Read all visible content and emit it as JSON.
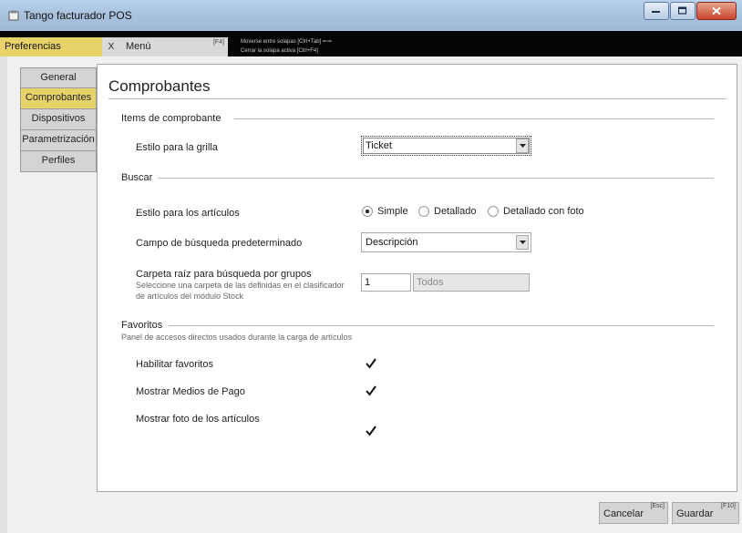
{
  "window": {
    "title": "Tango facturador POS"
  },
  "tabs": {
    "preferencias": "Preferencias",
    "close": "X",
    "menu": "Menú",
    "menu_key": "[F4]",
    "hint1": "Moverse entre solapas [Ctrl+Tab] ⇐⇒",
    "hint2": "Cerrar la solapa activa [Ctrl+F4]"
  },
  "nav": {
    "items": [
      "General",
      "Comprobantes",
      "Dispositivos",
      "Parametrización",
      "Perfiles"
    ],
    "active": "Comprobantes"
  },
  "panel": {
    "title": "Comprobantes",
    "items_section": {
      "label": "Items de comprobante",
      "grid_style_label": "Estilo para la grilla",
      "grid_style_value": "Ticket"
    },
    "buscar_section": {
      "label": "Buscar",
      "article_style_label": "Estilo para los artículos",
      "options": [
        "Simple",
        "Detallado",
        "Detallado con foto"
      ],
      "selected_option": "Simple",
      "default_field_label": "Campo de búsqueda predeterminado",
      "default_field_value": "Descripción",
      "root_folder_label": "Carpeta raíz para búsqueda por grupos",
      "root_folder_hint1": "Seleccione una carpeta de las definidas en el clasificador",
      "root_folder_hint2": "de artículos del módulo Stock",
      "root_folder_code": "1",
      "root_folder_name": "Todos"
    },
    "favoritos_section": {
      "label": "Favoritos",
      "hint": "Panel de accesos directos usados durante la carga de artículos",
      "enable_label": "Habilitar favoritos",
      "enable_checked": true,
      "payment_label": "Mostrar Medios de Pago",
      "payment_checked": true,
      "photo_label": "Mostrar foto de los artículos",
      "photo_checked": true
    }
  },
  "footer": {
    "cancel_label": "Cancelar",
    "cancel_key": "[Esc]",
    "save_label": "Guardar",
    "save_key": "[F10]"
  },
  "colors": {
    "accent": "#e8d36a",
    "titlebar": "#a9c3df",
    "tabsbar": "#050505"
  }
}
